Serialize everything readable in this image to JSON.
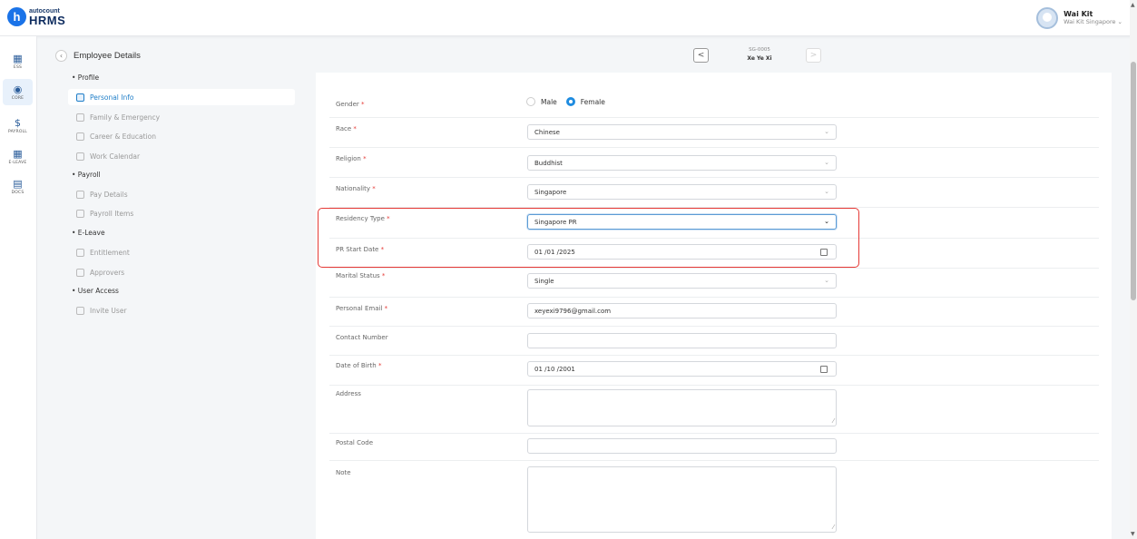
{
  "app": {
    "logo_letter": "h",
    "logo_top": "autocount",
    "logo_bottom": "HRMS"
  },
  "user": {
    "name": "Wai Kit",
    "org": "Wai Kit Singapore ⌄"
  },
  "rail": [
    {
      "label": "ESS",
      "icon": "▦"
    },
    {
      "label": "CORE",
      "icon": "◉"
    },
    {
      "label": "PAYROLL",
      "icon": "$"
    },
    {
      "label": "E-LEAVE",
      "icon": "▦"
    },
    {
      "label": "DOCS",
      "icon": "▤"
    }
  ],
  "page": {
    "title": "Employee Details",
    "back_icon": "‹",
    "prev_icon": "<",
    "next_icon": ">"
  },
  "employee": {
    "code": "SG-0005",
    "name": "Xe Ye Xi"
  },
  "subnav": {
    "sections": [
      "• Profile",
      "• Payroll",
      "• E-Leave",
      "• User Access"
    ],
    "items": [
      "Personal Info",
      "Family & Emergency",
      "Career & Education",
      "Work Calendar",
      "Pay Details",
      "Payroll Items",
      "Entitlement",
      "Approvers",
      "Invite User"
    ]
  },
  "form": {
    "required_mark": "*",
    "gender": {
      "label": "Gender",
      "options": [
        "Male",
        "Female"
      ],
      "selected": "Female"
    },
    "race": {
      "label": "Race",
      "value": "Chinese"
    },
    "religion": {
      "label": "Religion",
      "value": "Buddhist"
    },
    "nationality": {
      "label": "Nationality",
      "value": "Singapore"
    },
    "residency": {
      "label": "Residency Type",
      "value": "Singapore PR"
    },
    "pr_start": {
      "label": "PR Start Date",
      "value": "01 /01 /2025"
    },
    "marital": {
      "label": "Marital Status",
      "value": "Single"
    },
    "email": {
      "label": "Personal Email",
      "value": "xeyexi9796@gmail.com"
    },
    "contact": {
      "label": "Contact Number",
      "value": ""
    },
    "dob": {
      "label": "Date of Birth",
      "value": "01 /10 /2001"
    },
    "address": {
      "label": "Address",
      "value": ""
    },
    "postal": {
      "label": "Postal Code",
      "value": ""
    },
    "note": {
      "label": "Note",
      "value": ""
    }
  },
  "colors": {
    "accent": "#1f8ce0",
    "highlight": "#e53935",
    "required": "#e53935"
  }
}
